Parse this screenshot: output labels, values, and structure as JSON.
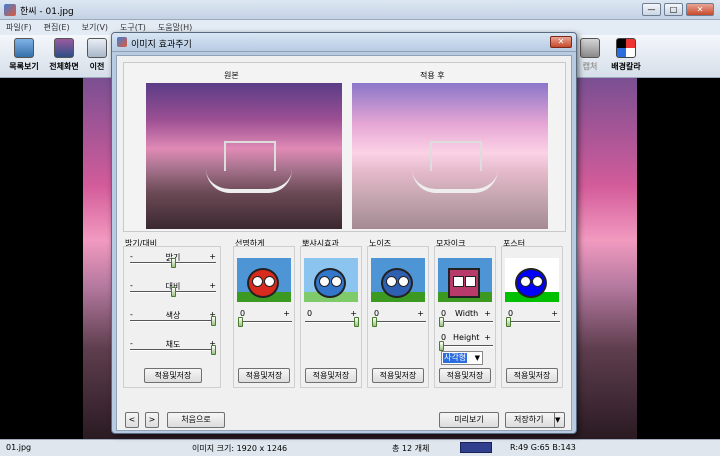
{
  "window": {
    "title": "한씨 - 01.jpg",
    "btn_min": "—",
    "btn_max": "□",
    "btn_close": "✕"
  },
  "menu": [
    "파일(F)",
    "편집(E)",
    "보기(V)",
    "도구(T)",
    "도움말(H)"
  ],
  "toolbar": {
    "items": [
      {
        "label": "목록보기",
        "icon": "list-view-icon"
      },
      {
        "label": "전체화면",
        "icon": "fullscreen-icon"
      },
      {
        "label": "이전",
        "icon": "previous-icon"
      },
      {
        "label": "캡처",
        "icon": "capture-icon",
        "disabled": true
      },
      {
        "label": "배경칼라",
        "icon": "background-color-icon"
      }
    ]
  },
  "dialog": {
    "title": "이미지 효과주기",
    "close": "✕",
    "preview": {
      "original_label": "원본",
      "after_label": "적용 후"
    },
    "brightness": {
      "title": "밝기/대비",
      "sliders": [
        {
          "name": "밝기",
          "value": 0.5
        },
        {
          "name": "대비",
          "value": 0.5
        },
        {
          "name": "색상",
          "value": 1.0
        },
        {
          "name": "채도",
          "value": 1.0
        }
      ],
      "minus": "-",
      "plus": "+",
      "apply": "적용및저장"
    },
    "effects": [
      {
        "title": "선명하게",
        "value_label": "0",
        "plus": "+",
        "apply": "적용및저장"
      },
      {
        "title": "뽀샤시효과",
        "value_label": "0",
        "plus": "+",
        "apply": "적용및저장"
      },
      {
        "title": "노이즈",
        "value_label": "0",
        "plus": "+",
        "apply": "적용및저장"
      },
      {
        "title": "모자이크",
        "width_label": "Width",
        "height_label": "Height",
        "value_label": "0",
        "plus": "+",
        "shape": "사각형",
        "apply": "적용및저장"
      },
      {
        "title": "포스터",
        "value_label": "0",
        "plus": "+",
        "apply": "적용및저장"
      }
    ],
    "footer": {
      "prev": "<",
      "next": ">",
      "reset": "처음으로",
      "preview": "미리보기",
      "save": "저장하기",
      "save_arrow": "▼"
    }
  },
  "status": {
    "filename": "01.jpg",
    "image_size": "이미지 크기: 1920 x 1246",
    "count": "총 12 개체",
    "swatch_color": "#313f8f",
    "rgb": "R:49 G:65 B:143"
  }
}
